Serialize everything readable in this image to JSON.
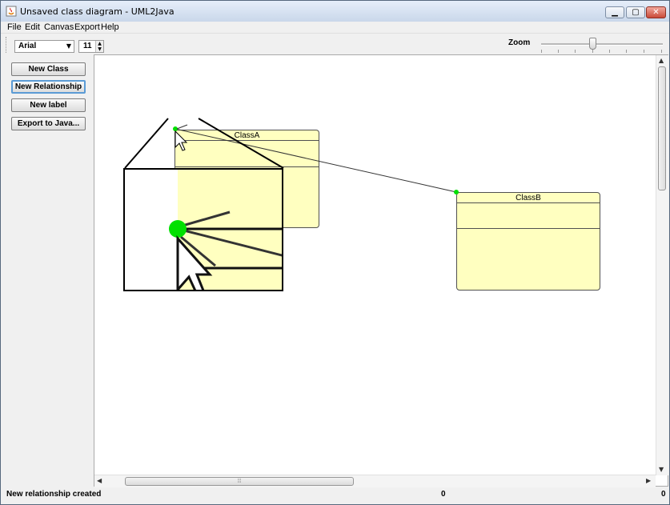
{
  "window": {
    "title": "Unsaved class diagram - UML2Java"
  },
  "menu": {
    "items": [
      "File",
      "Edit",
      "Canvas",
      "Export",
      "Help"
    ]
  },
  "toolbar": {
    "font_value": "Arial",
    "size_value": "11",
    "zoom_label": "Zoom",
    "zoom_level_fraction": 0.42
  },
  "left_panel": {
    "buttons": [
      "New Class",
      "New Relationship",
      "New label",
      "Export to Java..."
    ],
    "active_button": "New Relationship"
  },
  "canvas": {
    "classes": [
      {
        "name": "ClassA"
      },
      {
        "name": "ClassB"
      }
    ],
    "relationship_color": "#333333",
    "endpoint_color": "#00e000",
    "class_fill": "#ffffc0"
  },
  "status": {
    "message": "New relationship created",
    "value_1": "0",
    "value_2": "0"
  }
}
